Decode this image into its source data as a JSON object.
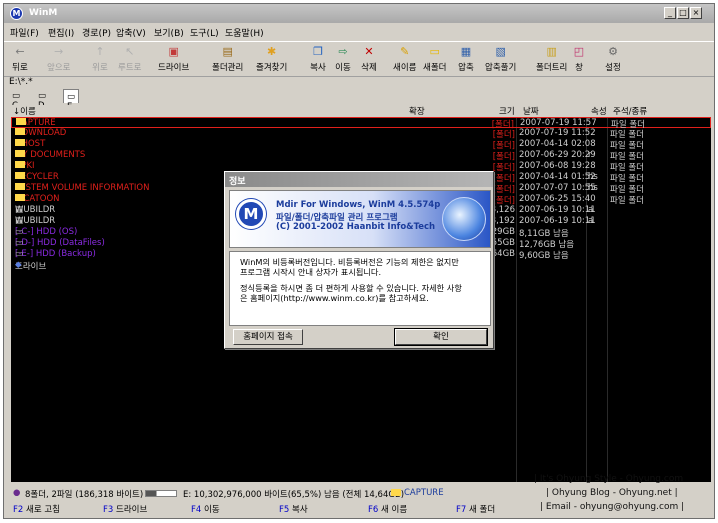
{
  "window": {
    "title": "WinM"
  },
  "menus": [
    "파일(F)",
    "편집(I)",
    "경로(P)",
    "압축(V)",
    "보기(B)",
    "도구(L)",
    "도움말(H)"
  ],
  "toolbar": [
    {
      "label": "뒤로",
      "icon": "back-arrow-icon",
      "disabled": false
    },
    {
      "label": "앞으로",
      "icon": "forward-arrow-icon",
      "disabled": true
    },
    {
      "label": "위로",
      "icon": "up-arrow-icon",
      "disabled": true
    },
    {
      "label": "루트로",
      "icon": "root-icon",
      "disabled": true
    },
    {
      "label": "드라이브",
      "icon": "drive-icon",
      "disabled": false
    },
    {
      "label": "폴더관리",
      "icon": "folder-manage-icon",
      "disabled": false
    },
    {
      "label": "즐겨찾기",
      "icon": "favorites-icon",
      "disabled": false
    },
    {
      "label": "복사",
      "icon": "copy-icon",
      "disabled": false
    },
    {
      "label": "이동",
      "icon": "move-icon",
      "disabled": false
    },
    {
      "label": "삭제",
      "icon": "delete-icon",
      "disabled": false
    },
    {
      "label": "새이름",
      "icon": "rename-icon",
      "disabled": false
    },
    {
      "label": "새폴더",
      "icon": "new-folder-icon",
      "disabled": false
    },
    {
      "label": "압축",
      "icon": "compress-icon",
      "disabled": false
    },
    {
      "label": "압축풀기",
      "icon": "extract-icon",
      "disabled": false
    },
    {
      "label": "폴더트리",
      "icon": "folder-tree-icon",
      "disabled": false
    },
    {
      "label": "창",
      "icon": "window-icon",
      "disabled": false
    },
    {
      "label": "설정",
      "icon": "settings-icon",
      "disabled": false
    }
  ],
  "path": "E:\\*.*",
  "drives": [
    "C",
    "D",
    "E"
  ],
  "columns": {
    "name": "↓이름",
    "ext": "확장",
    "size": "크기",
    "date": "날짜",
    "attr": "속성",
    "kind": "주석/종류"
  },
  "files": [
    {
      "name": "CAPTURE",
      "size": "[폴더]",
      "date": "2007-07-19 11:57",
      "attr": "",
      "kind": "파일 폴더"
    },
    {
      "name": "DOWNLOAD",
      "size": "[폴더]",
      "date": "2007-07-19 11:52",
      "attr": "",
      "kind": "파일 폴더"
    },
    {
      "name": "GHOST",
      "size": "[폴더]",
      "date": "2007-04-14 02:08",
      "attr": "",
      "kind": "파일 폴더"
    },
    {
      "name": "MY DOCUMENTS",
      "size": "[폴더]",
      "date": "2007-06-29 20:29",
      "attr": "r",
      "kind": "파일 폴더"
    },
    {
      "name": "NPKI",
      "size": "[폴더]",
      "date": "2007-06-08 19:28",
      "attr": "",
      "kind": "파일 폴더"
    },
    {
      "name": "RECYCLER",
      "size": "[폴더]",
      "date": "2007-04-14 01:52",
      "attr": "hs",
      "kind": "파일 폴더"
    },
    {
      "name": "SYSTEM VOLUME INFORMATION",
      "size": "[폴더]",
      "date": "2007-07-07 10:55",
      "attr": "hs",
      "kind": "파일 폴더"
    },
    {
      "name": "X-CATOON",
      "size": "[폴더]",
      "date": "2007-06-25 15:40",
      "attr": "",
      "kind": "파일 폴더"
    },
    {
      "name": "WUBILDR",
      "size": "8,126",
      "date": "2007-06-19 10:11",
      "attr": "a",
      "kind": ""
    },
    {
      "name": "WUBILDR",
      "size": "8,192",
      "date": "2007-06-19 10:11",
      "attr": "a",
      "kind": ""
    },
    {
      "name": "[-C-] HDD (OS)",
      "size": "29GB",
      "date": "8,11GB 남음",
      "attr": "",
      "kind": ""
    },
    {
      "name": "[-D-] HDD (DataFiles)",
      "size": "55GB",
      "date": "12,76GB 남음",
      "attr": "",
      "kind": ""
    },
    {
      "name": "[-E-] HDD (Backup)",
      "size": "64GB",
      "date": "9,60GB 남음",
      "attr": "",
      "kind": ""
    },
    {
      "name": "드라이브",
      "size": "",
      "date": "",
      "attr": "",
      "kind": ""
    }
  ],
  "status": {
    "summary": "8폴더, 2파일 (186,318 바이트)",
    "disk": "E: 10,302,976,000 바이트(65,5%) 남음 (전체 14,64GB)",
    "folder": "CAPTURE"
  },
  "fkeys": [
    {
      "key": "F2",
      "label": "새로 고침"
    },
    {
      "key": "F3",
      "label": "드라이브"
    },
    {
      "key": "F4",
      "label": "이동"
    },
    {
      "key": "F5",
      "label": "복사"
    },
    {
      "key": "F6",
      "label": "새 이름"
    },
    {
      "key": "F7",
      "label": "새 폴더"
    }
  ],
  "watermark": [
    "| It's Ohyung Style - Ohyung.com",
    "| Ohyung Blog - Ohyung.net |",
    "| Email - ohyung@ohyung.com |"
  ],
  "dialog": {
    "title": "정보",
    "banner": [
      "Mdir For Windows, WinM 4.5.574p",
      "파일/폴더/압축파일 관리 프로그램",
      "(C) 2001-2002 Haanbit Info&Tech"
    ],
    "message": [
      "WinM의 비등록버전입니다. 비등록버전은 기능의 제한은 없지만",
      "프로그램 시작시 안내 상자가 표시됩니다.",
      "",
      "정식등록을 하시면 좀 더 편하게 사용할 수 있습니다. 자세한 사항",
      "은 홈페이지(http://www.winm.co.kr)를 참고하세요."
    ],
    "homepage_button": "홈페이지 접속",
    "ok_button": "확인"
  }
}
